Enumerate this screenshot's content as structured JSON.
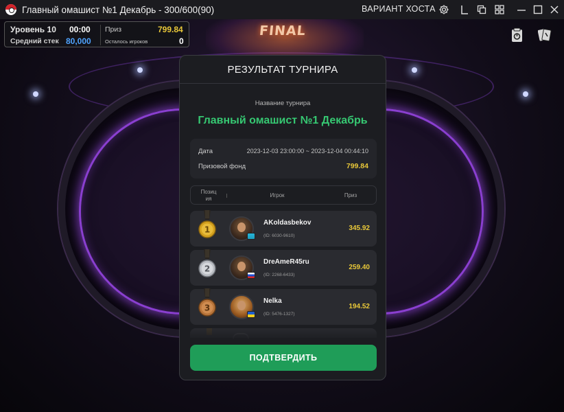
{
  "window": {
    "title": "Главный омашист №1 Декабрь - 300/600(90)",
    "host_variant": "ВАРИАНТ ХОСТА",
    "icons": [
      "gear-icon",
      "layout-l-icon",
      "copy-windows-icon",
      "grid-icon",
      "minimize-icon",
      "maximize-icon",
      "close-icon"
    ]
  },
  "hud": {
    "level_label": "Уровень 10",
    "timer": "00:00",
    "prize_label": "Приз",
    "prize_value": "799.84",
    "avg_stack_label": "Средний стек",
    "avg_stack_value": "80,000",
    "players_left_label": "Осталось игроков",
    "players_left_value": "0"
  },
  "scene": {
    "sign": "FINAL"
  },
  "dialog": {
    "title": "РЕЗУЛЬТАТ ТУРНИРА",
    "tournament_name_label": "Название турнира",
    "tournament_name": "Главный омашист №1 Декабрь",
    "date_label": "Дата",
    "date_value": "2023-12-03 23:00:00 ~ 2023-12-04 00:44:10",
    "prize_pool_label": "Призовой фонд",
    "prize_pool_value": "799.84",
    "columns": {
      "position_line1": "Позиц",
      "position_line2": "ия",
      "player": "Игрок",
      "prize": "Приз"
    },
    "results": [
      {
        "place": "1",
        "name": "AKoldasbekov",
        "id": "(ID: 6030-9610)",
        "prize": "345.92",
        "medal": "gold",
        "flag": "kazakhstan"
      },
      {
        "place": "2",
        "name": "DreAmeR45ru",
        "id": "(ID: 2268-6433)",
        "prize": "259.40",
        "medal": "silver",
        "flag": "russia"
      },
      {
        "place": "3",
        "name": "Nelka",
        "id": "(ID: 5476-1327)",
        "prize": "194.52",
        "medal": "bronze",
        "flag": "ukraine"
      }
    ],
    "confirm_button": "ПОДТВЕРДИТЬ"
  },
  "colors": {
    "accent_green": "#36c872",
    "button_green": "#1f9d58",
    "prize_yellow": "#e9c839",
    "gold": "#d4a11e",
    "silver": "#b9bcc2",
    "bronze": "#b8743a"
  }
}
